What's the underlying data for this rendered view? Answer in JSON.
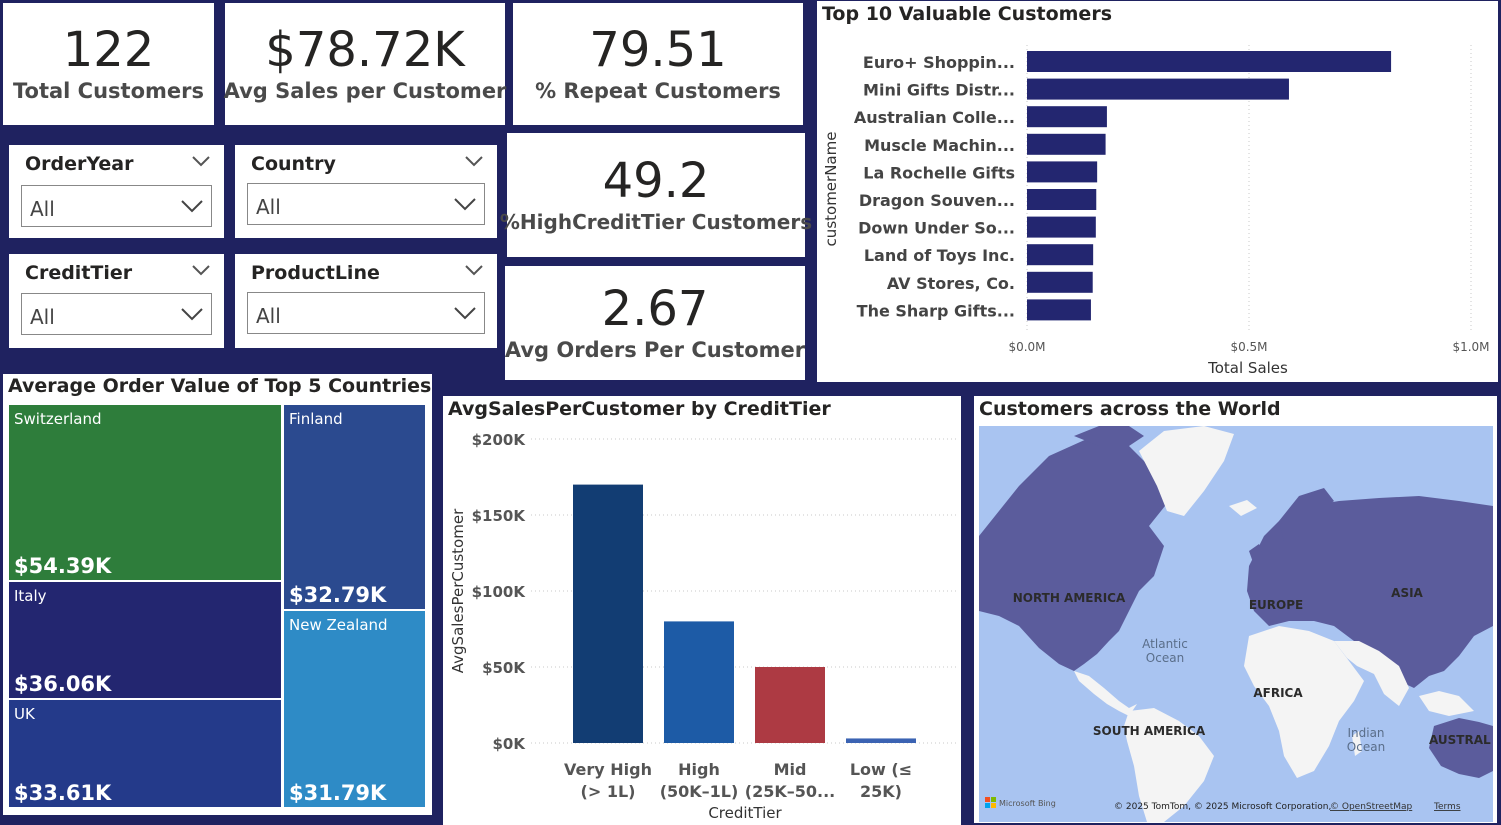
{
  "kpis": {
    "total_customers": {
      "value": "122",
      "label": "Total Customers"
    },
    "avg_sales": {
      "value": "$78.72K",
      "label": "Avg Sales per Customer"
    },
    "repeat": {
      "value": "79.51",
      "label": "% Repeat Customers"
    },
    "high_credit": {
      "value": "49.2",
      "label": "%HighCreditTier Customers"
    },
    "avg_orders": {
      "value": "2.67",
      "label": "Avg Orders Per Customer"
    }
  },
  "slicers": {
    "order_year": {
      "title": "OrderYear",
      "value": "All"
    },
    "country": {
      "title": "Country",
      "value": "All"
    },
    "credit_tier": {
      "title": "CreditTier",
      "value": "All"
    },
    "product_line": {
      "title": "ProductLine",
      "value": "All"
    }
  },
  "top_customers": {
    "title": "Top 10 Valuable Customers",
    "ylabel": "customerName",
    "xlabel": "Total Sales",
    "ticks": [
      "$0.0M",
      "$0.5M",
      "$1.0M"
    ]
  },
  "treemap": {
    "title": "Average Order Value of Top 5 Countries",
    "tiles": [
      {
        "name": "Switzerland",
        "value": "$54.39K",
        "color": "#2e7d3b"
      },
      {
        "name": "Italy",
        "value": "$36.06K",
        "color": "#232670"
      },
      {
        "name": "UK",
        "value": "$33.61K",
        "color": "#243a8a"
      },
      {
        "name": "Finland",
        "value": "$32.79K",
        "color": "#2b4a8f"
      },
      {
        "name": "New Zealand",
        "value": "$31.79K",
        "color": "#2e8bc6"
      }
    ]
  },
  "credit_chart": {
    "title": "AvgSalesPerCustomer by CreditTier",
    "ylabel": "AvgSalesPerCustomer",
    "xlabel": "CreditTier",
    "ticks": [
      "$0K",
      "$50K",
      "$100K",
      "$150K",
      "$200K"
    ]
  },
  "map": {
    "title": "Customers across the World",
    "labels": {
      "north_america": "NORTH AMERICA",
      "europe": "EUROPE",
      "asia": "ASIA",
      "atlantic1": "Atlantic",
      "atlantic2": "Ocean",
      "africa": "AFRICA",
      "south_america": "SOUTH AMERICA",
      "indian1": "Indian",
      "indian2": "Ocean",
      "australia": "AUSTRAL"
    },
    "logo": "Microsoft Bing",
    "copyright": "© 2025 TomTom, © 2025 Microsoft Corporation,",
    "osm": "© OpenStreetMap",
    "terms": "Terms"
  },
  "chart_data": [
    {
      "type": "bar",
      "title": "Top 10 Valuable Customers",
      "orientation": "horizontal",
      "xlabel": "Total Sales",
      "ylabel": "customerName",
      "categories": [
        "Euro+ Shoppin...",
        "Mini Gifts Distr...",
        "Australian Colle...",
        "Muscle Machin...",
        "La Rochelle Gifts",
        "Dragon Souven...",
        "Down Under So...",
        "Land of Toys Inc.",
        "AV Stores, Co.",
        "The Sharp Gifts..."
      ],
      "values": [
        0.82,
        0.59,
        0.18,
        0.177,
        0.158,
        0.156,
        0.155,
        0.149,
        0.148,
        0.144
      ],
      "xlim": [
        0,
        1.0
      ],
      "color": "#232670"
    },
    {
      "type": "bar",
      "title": "AvgSalesPerCustomer by CreditTier",
      "xlabel": "CreditTier",
      "ylabel": "AvgSalesPerCustomer",
      "categories": [
        "Very High (> 1L)",
        "High (50K–1L)",
        "Mid (25K–50...",
        "Low (≤ 25K)"
      ],
      "category_lines": [
        [
          "Very High",
          "(> 1L)"
        ],
        [
          "High",
          "(50K–1L)"
        ],
        [
          "Mid",
          "(25K–50..."
        ],
        [
          "Low (≤",
          "25K)"
        ]
      ],
      "values": [
        170000,
        80000,
        50000,
        3000
      ],
      "colors": [
        "#123d73",
        "#1d5ba6",
        "#ad3a43",
        "#3b63b3"
      ],
      "ylim": [
        0,
        200000
      ]
    },
    {
      "type": "treemap",
      "title": "Average Order Value of Top 5 Countries",
      "categories": [
        "Switzerland",
        "Italy",
        "UK",
        "Finland",
        "New Zealand"
      ],
      "values": [
        54390,
        36060,
        33610,
        32790,
        31790
      ]
    }
  ]
}
